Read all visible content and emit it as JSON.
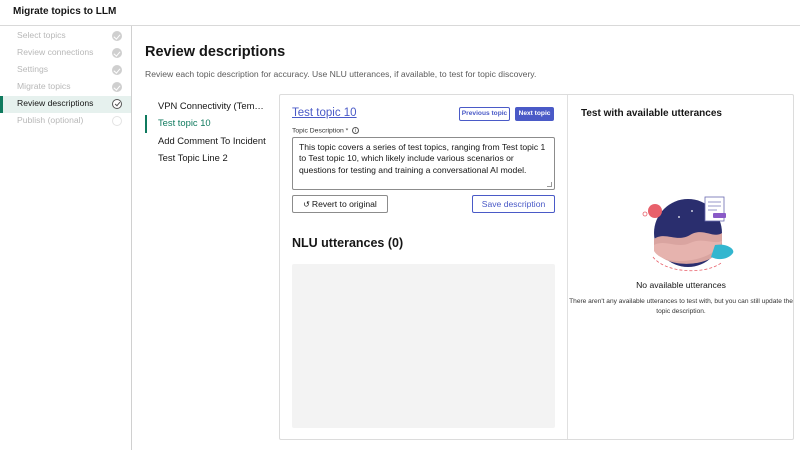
{
  "app": {
    "title": "Migrate topics to LLM"
  },
  "steps": [
    {
      "label": "Select topics",
      "state": "done"
    },
    {
      "label": "Review connections",
      "state": "done"
    },
    {
      "label": "Settings",
      "state": "done"
    },
    {
      "label": "Migrate topics",
      "state": "done"
    },
    {
      "label": "Review descriptions",
      "state": "active"
    },
    {
      "label": "Publish (optional)",
      "state": "pending"
    }
  ],
  "page": {
    "title": "Review descriptions",
    "subtitle": "Review each topic description for accuracy. Use NLU utterances, if available, to test for topic discovery."
  },
  "topics": [
    {
      "label": "VPN Connectivity (Temp..."
    },
    {
      "label": "Test topic 10",
      "selected": true
    },
    {
      "label": "Add Comment To Incident"
    },
    {
      "label": "Test Topic Line 2"
    }
  ],
  "editor": {
    "topic_name": "Test topic 10",
    "prev_label": "Previous topic",
    "next_label": "Next topic",
    "description_label": "Topic Description",
    "required_mark": "*",
    "info_glyph": "i",
    "description": "This topic covers a series of test topics, ranging from Test topic 1 to Test topic 10, which likely include various scenarios or questions for testing and training a conversational AI model.",
    "revert_label": "Revert to original",
    "save_label": "Save description",
    "nlu_title": "NLU utterances (0)"
  },
  "test_panel": {
    "title": "Test with available utterances",
    "empty_title": "No available utterances",
    "empty_text": "There aren't any available utterances to test with, but you can still update the topic description."
  },
  "colors": {
    "accent": "#4a5ac7",
    "active_green": "#0f7a5e",
    "active_bg": "#e6f1ee"
  }
}
